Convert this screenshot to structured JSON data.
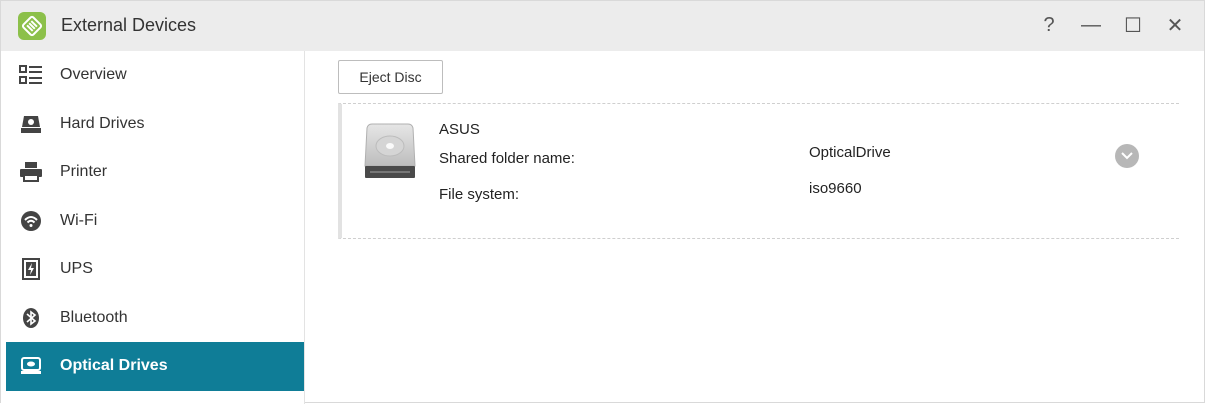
{
  "window": {
    "title": "External Devices",
    "app_icon": "external-devices-icon",
    "controls": [
      {
        "name": "help-button",
        "icon": "question-icon",
        "glyph": "?"
      },
      {
        "name": "minimize-button",
        "icon": "minimize-icon",
        "glyph": "—"
      },
      {
        "name": "maximize-button",
        "icon": "maximize-icon",
        "glyph": "☐"
      },
      {
        "name": "close-button",
        "icon": "close-icon",
        "glyph": "✕"
      }
    ]
  },
  "sidebar": {
    "items": [
      {
        "label": "Overview",
        "icon": "overview-icon"
      },
      {
        "label": "Hard Drives",
        "icon": "hard-drive-icon"
      },
      {
        "label": "Printer",
        "icon": "printer-icon"
      },
      {
        "label": "Wi-Fi",
        "icon": "wifi-icon"
      },
      {
        "label": "UPS",
        "icon": "ups-icon"
      },
      {
        "label": "Bluetooth",
        "icon": "bluetooth-icon"
      },
      {
        "label": "Optical Drives",
        "icon": "optical-drive-icon",
        "active": true
      }
    ]
  },
  "toolbar": {
    "eject_label": "Eject Disc"
  },
  "device": {
    "name": "ASUS",
    "shared_folder_label": "Shared folder name:",
    "shared_folder_value": "OpticalDrive",
    "file_system_label": "File system:",
    "file_system_value": "iso9660"
  },
  "colors": {
    "accent": "#0f7d97",
    "titlebar": "#ececec",
    "app_icon": "#8cc04a"
  }
}
